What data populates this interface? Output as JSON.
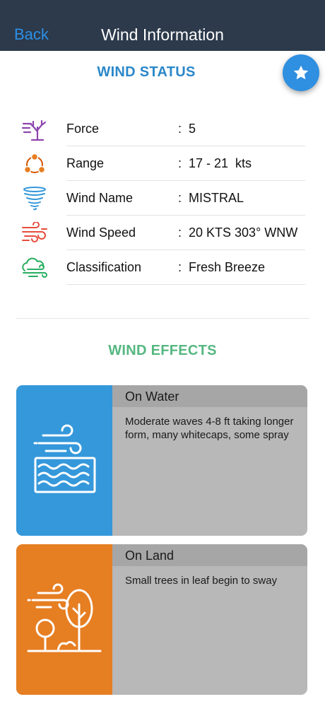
{
  "nav": {
    "back_label": "Back",
    "title": "Wind Information"
  },
  "status": {
    "title": "WIND STATUS",
    "rows": [
      {
        "icon": "tree-wind-icon",
        "label": "Force",
        "colon": ":",
        "value": "5"
      },
      {
        "icon": "range-cycle-icon",
        "label": "Range",
        "colon": ":",
        "value": "17 - 21  kts"
      },
      {
        "icon": "tornado-icon",
        "label": "Wind Name",
        "colon": ":",
        "value": "MISTRAL"
      },
      {
        "icon": "wind-speed-icon",
        "label": "Wind Speed",
        "colon": ":",
        "value": "20 KTS 303° WNW"
      },
      {
        "icon": "cloud-wind-icon",
        "label": "Classification",
        "colon": ":",
        "value": "Fresh Breeze"
      }
    ]
  },
  "favorite": {
    "icon": "star-icon"
  },
  "effects": {
    "title": "WIND EFFECTS",
    "cards": [
      {
        "icon": "waves-wind-icon",
        "heading": "On Water",
        "text": "Moderate waves 4-8 ft taking longer form, many whitecaps, some spray",
        "color": "#3598db"
      },
      {
        "icon": "trees-wind-icon",
        "heading": "On Land",
        "text": "Small trees in leaf begin to sway",
        "color": "#e67e22"
      }
    ]
  },
  "colors": {
    "navbar": "#2c3a4b",
    "link": "#2d8fe6",
    "status_title": "#2b87c9",
    "effects_title": "#55b780",
    "card_body": "#b8b8b8",
    "card_header": "#a6a6a6"
  }
}
